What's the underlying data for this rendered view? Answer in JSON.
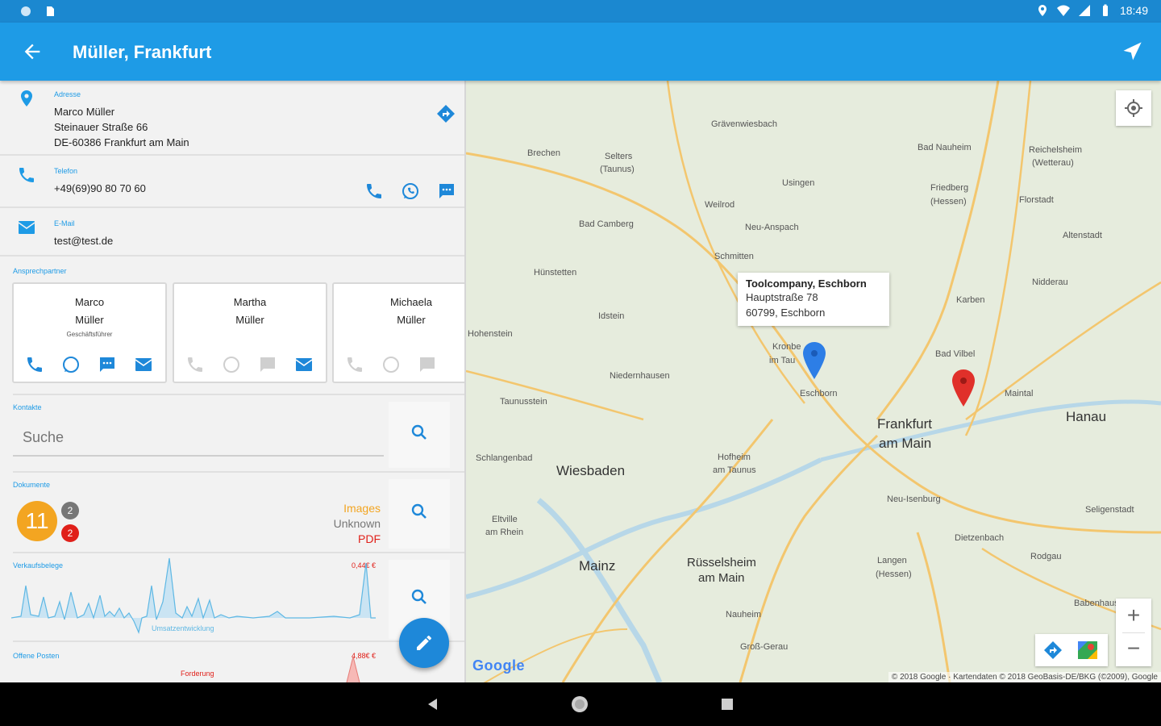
{
  "status": {
    "time": "18:49"
  },
  "appbar": {
    "title": "Müller, Frankfurt"
  },
  "address": {
    "label": "Adresse",
    "name": "Marco Müller",
    "street": "Steinauer Straße 66",
    "city": "DE-60386 Frankfurt am Main"
  },
  "phone": {
    "label": "Telefon",
    "value": "+49(69)90 80 70 60"
  },
  "email": {
    "label": "E-Mail",
    "value": "test@test.de"
  },
  "contacts": {
    "label": "Ansprechpartner",
    "items": [
      {
        "first": "Marco",
        "last": "Müller",
        "role": "Geschäftsführer"
      },
      {
        "first": "Martha",
        "last": "Müller",
        "role": ""
      },
      {
        "first": "Michaela",
        "last": "Müller",
        "role": ""
      }
    ]
  },
  "kontakte": {
    "label": "Kontakte",
    "placeholder": "Suche"
  },
  "dokumente": {
    "label": "Dokumente",
    "count": "11",
    "badge_gray": "2",
    "badge_red": "2",
    "types": [
      "Images",
      "Unknown",
      "PDF"
    ]
  },
  "verkauf": {
    "label": "Verkaufsbelege",
    "max": "0,44€ €",
    "caption": "Umsatzentwicklung"
  },
  "offene": {
    "label": "Offene Posten",
    "max": "4,88€ €",
    "caption": "Forderung"
  },
  "map": {
    "popup": {
      "title": "Toolcompany, Eschborn",
      "line1": "Hauptstraße 78",
      "line2": "60799, Eschborn"
    },
    "labels": {
      "frankfurt1": "Frankfurt",
      "frankfurt2": "am Main",
      "wiesbaden": "Wiesbaden",
      "mainz": "Mainz",
      "hanau": "Hanau",
      "eschborn": "Eschborn",
      "ruesselsheim1": "Rüsselsheim",
      "ruesselsheim2": "am Main",
      "badnauheim": "Bad Nauheim",
      "friedberg1": "Friedberg",
      "friedberg2": "(Hessen)",
      "usingen": "Usingen",
      "badcamberg": "Bad Camberg",
      "neuanspach": "Neu-Anspach",
      "schmitten": "Schmitten",
      "badvilbel": "Bad Vilbel",
      "maintal": "Maintal",
      "neuisenburg": "Neu-Isenburg",
      "dietzenbach": "Dietzenbach",
      "langen1": "Langen",
      "langen2": "(Hessen)",
      "rodgau": "Rodgau",
      "niedernhausen": "Niedernhausen",
      "taunusstein": "Taunusstein",
      "hofheim1": "Hofheim",
      "hofheim2": "am Taunus",
      "nauheim": "Nauheim",
      "grossgerau": "Groß-Gerau",
      "karben": "Karben",
      "nidderau": "Nidderau",
      "altenstadt": "Altenstadt",
      "florstadt": "Florstadt",
      "weilrod": "Weilrod",
      "brechen": "Brechen",
      "huenstetten": "Hünstetten",
      "idstein": "Idstein",
      "schlangenbad": "Schlangenbad",
      "eltville1": "Eltville",
      "eltville2": "am Rhein",
      "babenhausen": "Babenhausen",
      "seligenstadt": "Seligenstadt",
      "kronberg1": "Kronbe",
      "kronberg2": "im Tau",
      "graevenwiesbach": "Grävenwiesbach",
      "selters1": "Selters",
      "selters2": "(Taunus)",
      "hohenstein": "Hohenstein",
      "reichelsheim1": "Reichelsheim",
      "reichelsheim2": "(Wetterau)"
    },
    "logo": "Google",
    "copyright": "© 2018 Google · Kartendaten © 2018 GeoBasis-DE/BKG (©2009), Google"
  }
}
